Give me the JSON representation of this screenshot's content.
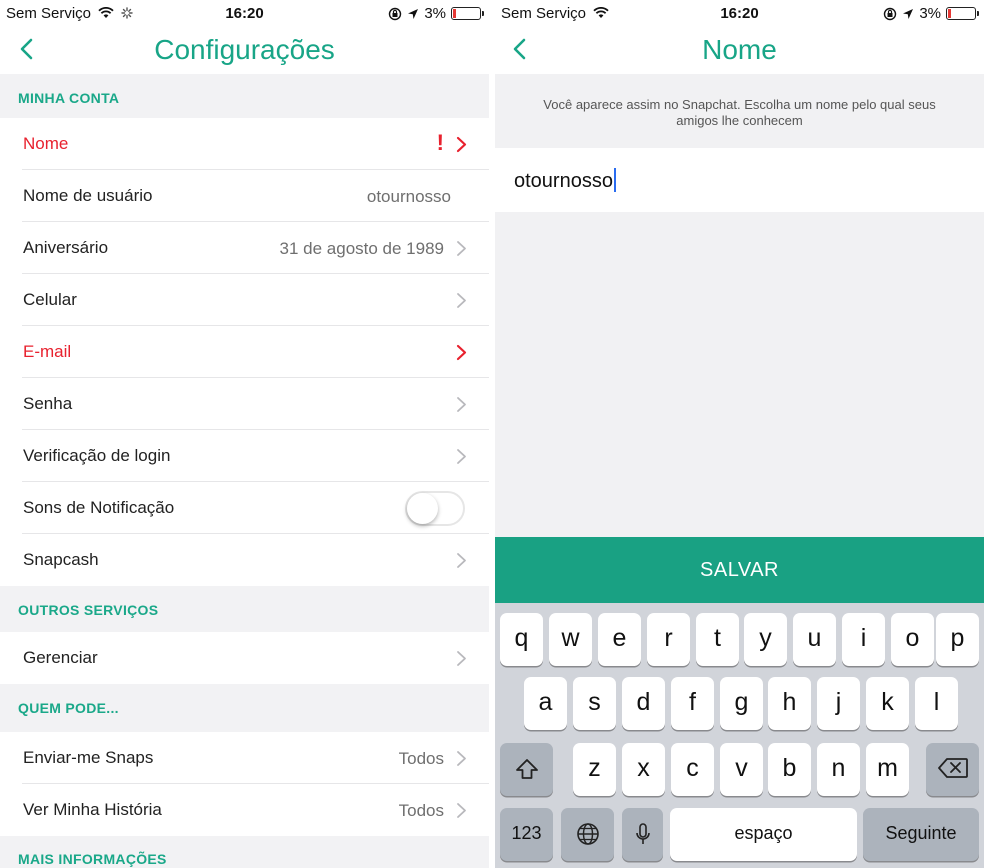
{
  "status_bar": {
    "carrier": "Sem Serviço",
    "time": "16:20",
    "battery": "3%",
    "battery_level": 0.03,
    "icons": [
      "wifi-icon",
      "loading-icon",
      "orientation-lock-icon",
      "location-arrow-icon",
      "battery-icon"
    ]
  },
  "settings_screen": {
    "back_icon": "chevron-left-icon",
    "title": "Configurações",
    "sections": {
      "minha_conta": "MINHA CONTA",
      "outros_servicos": "OUTROS SERVIÇOS",
      "quem_pode": "QUEM PODE...",
      "mais_informacoes": "MAIS INFORMAÇÕES"
    },
    "rows": {
      "nome": {
        "label": "Nome",
        "alert": "!"
      },
      "nome_usuario": {
        "label": "Nome de usuário",
        "value": "otournosso"
      },
      "aniversario": {
        "label": "Aniversário",
        "value": "31 de agosto de 1989"
      },
      "celular": {
        "label": "Celular"
      },
      "email": {
        "label": "E-mail"
      },
      "senha": {
        "label": "Senha"
      },
      "verificacao": {
        "label": "Verificação de login"
      },
      "sons": {
        "label": "Sons de Notificação",
        "toggle_on": false
      },
      "snapcash": {
        "label": "Snapcash"
      },
      "gerenciar": {
        "label": "Gerenciar"
      },
      "enviar_snaps": {
        "label": "Enviar-me Snaps",
        "value": "Todos"
      },
      "ver_historia": {
        "label": "Ver Minha História",
        "value": "Todos"
      }
    },
    "colors": {
      "accent": "#18a587",
      "alert": "#e8212e"
    }
  },
  "name_screen": {
    "back_icon": "chevron-left-icon",
    "title": "Nome",
    "hint": "Você aparece assim no Snapchat. Escolha um nome pelo qual seus amigos lhe conhecem",
    "name_value": "otournosso",
    "save_label": "SALVAR",
    "save_color": "#19a183"
  },
  "keyboard": {
    "row1": [
      "q",
      "w",
      "e",
      "r",
      "t",
      "y",
      "u",
      "i",
      "o",
      "p"
    ],
    "row2": [
      "a",
      "s",
      "d",
      "f",
      "g",
      "h",
      "j",
      "k",
      "l"
    ],
    "row3": [
      "z",
      "x",
      "c",
      "v",
      "b",
      "n",
      "m"
    ],
    "numbers_label": "123",
    "space_label": "espaço",
    "return_label": "Seguinte",
    "icons": [
      "shift-icon",
      "backspace-icon",
      "globe-icon",
      "microphone-icon"
    ]
  }
}
